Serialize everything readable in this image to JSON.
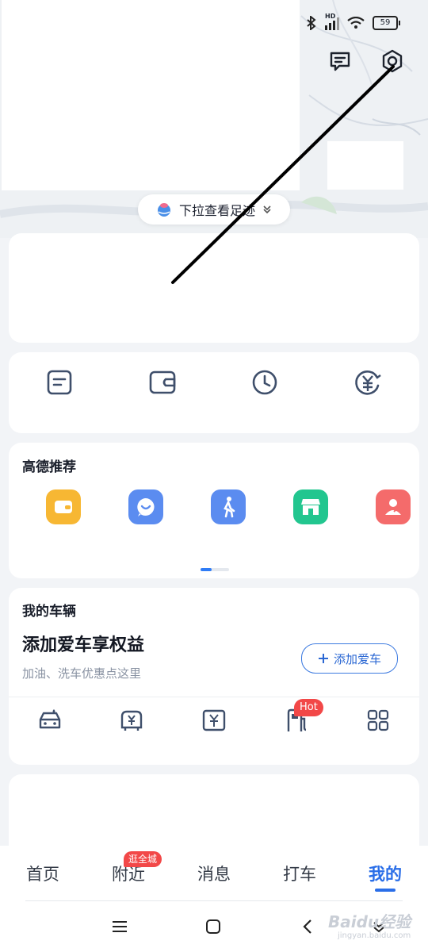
{
  "status_bar": {
    "network": "HD",
    "battery": "59"
  },
  "footprint_pill": {
    "label": "下拉查看足迹"
  },
  "recommend": {
    "title": "高德推荐"
  },
  "vehicle": {
    "title": "我的车辆",
    "headline": "添加爱车享权益",
    "subtitle": "加油、洗车优惠点这里",
    "add_button": "添加爱车",
    "hot_badge": "Hot"
  },
  "tabs": [
    {
      "label": "首页"
    },
    {
      "label": "附近",
      "badge": "逛全城"
    },
    {
      "label": "消息"
    },
    {
      "label": "打车"
    },
    {
      "label": "我的"
    }
  ],
  "watermark": {
    "brand": "Baidu经验",
    "url": "jingyan.baidu.com"
  },
  "colors": {
    "accent": "#2a6ee8",
    "badge": "#f24848",
    "tile_yellow": "#f7b733",
    "tile_blue": "#5b8cf0",
    "tile_green": "#22c68f",
    "tile_red": "#f46b6b"
  }
}
